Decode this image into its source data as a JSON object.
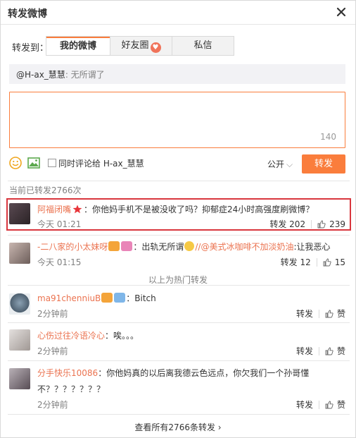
{
  "header": {
    "title": "转发微博"
  },
  "forward": {
    "label": "转发到：",
    "tabs": [
      {
        "label": "我的微博",
        "active": true
      },
      {
        "label": "好友圈",
        "active": false
      },
      {
        "label": "私信",
        "active": false
      }
    ]
  },
  "quote": {
    "user": "@H-ax_慧慧",
    "text": ": 无所谓了"
  },
  "composer": {
    "value": "",
    "remaining": "140"
  },
  "tools": {
    "also_comment_label": "同时评论给 H-ax_慧慧",
    "visibility": "公开",
    "send_label": "转发"
  },
  "reposts_title": "当前已转发2766次",
  "hot_reposts": [
    {
      "name": "阿福闭嘴",
      "content": "：你他妈手机不是被没收了吗？抑郁症24小时高强度刷微博？",
      "time": "今天 01:21",
      "repost_label": "转发 202",
      "likes": "239"
    },
    {
      "name": "-二八家的小太妹呀",
      "content_before": "：出轨无所谓",
      "mention": "//@美式冰咖啡不加淡奶油",
      "content_after": ":让我恶心",
      "time": "今天 01:15",
      "repost_label": "转发 12",
      "likes": "15"
    }
  ],
  "hot_divider": "以上为热门转发",
  "reposts": [
    {
      "name": "ma91chenniuB",
      "content": "：Bitch",
      "time": "2分钟前",
      "repost_label": "转发",
      "like_label": "赞"
    },
    {
      "name": "心伤过往冷语冷心",
      "content": "：唉。。。",
      "time": "2分钟前",
      "repost_label": "转发",
      "like_label": "赞"
    },
    {
      "name": "分手快乐10086",
      "content": "：你他妈真的以后离我德云色远点，你欠我们一个孙哥懂",
      "content_cont": "不？？？？？？？",
      "time": "2分钟前",
      "repost_label": "转发",
      "like_label": "赞"
    }
  ],
  "footer": {
    "view_all": "查看所有2766条转发 ›"
  },
  "colors": {
    "accent": "#fa7d3c",
    "name": "#eb7350",
    "highlight": "#d9363e"
  },
  "icons": [
    "close-icon",
    "heart-icon",
    "emoji-icon",
    "image-icon",
    "chevron-down-icon",
    "thumbs-up-icon",
    "star-badge-icon"
  ]
}
